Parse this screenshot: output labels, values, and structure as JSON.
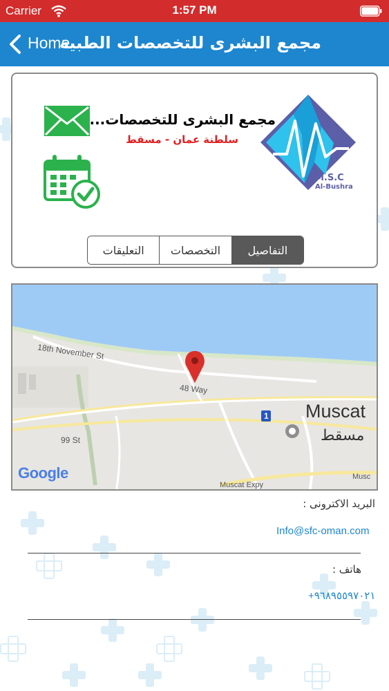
{
  "status_bar": {
    "carrier": "Carrier",
    "time": "1:57 PM"
  },
  "nav": {
    "back_label": "Home",
    "title": "مجمع البشرى للتخصصات الطبية"
  },
  "clinic": {
    "name": "مجمع البشرى للتخصصات...",
    "location": "سلطنة عمان - مسقط",
    "logo_text_1": "M.S.C",
    "logo_text_2": "Al-Bushra"
  },
  "tabs": [
    {
      "label": "التعليقات",
      "active": false
    },
    {
      "label": "التخصصات",
      "active": false
    },
    {
      "label": "التفاصيل",
      "active": true
    }
  ],
  "map": {
    "street_1": "18th November St",
    "street_2": "48 Way",
    "street_3": "99 St",
    "city_en": "Muscat",
    "city_ar": "مسقط",
    "road_marker": "1",
    "expressway_1": "Muscat Expy",
    "expressway_2": "Musc",
    "google_logo": "Google"
  },
  "contact": {
    "email_label": "البريد الاكترونى :",
    "email_value": "Info@sfc-oman.com",
    "phone_label": "هاتف :",
    "phone_value": "+٩٦٨٩٥٥٩٧٠٢١"
  },
  "colors": {
    "status_bar": "#d32c2c",
    "nav_bar": "#1e86cf",
    "accent_green": "#2bb24c",
    "link_blue": "#1e86cf",
    "location_red": "#e22020"
  }
}
